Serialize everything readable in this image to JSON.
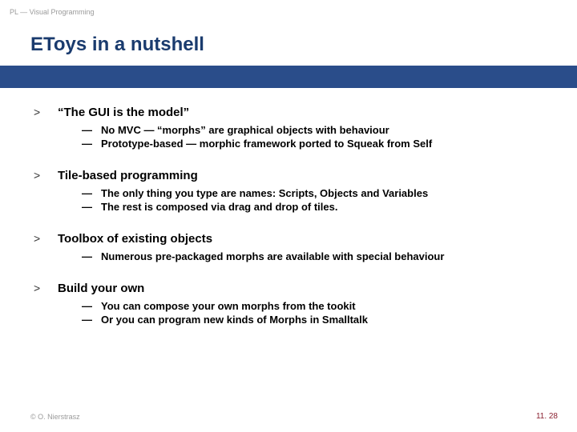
{
  "header": "PL — Visual Programming",
  "title": "EToys in a nutshell",
  "sections": [
    {
      "title": "“The GUI is the model”",
      "subs": [
        "No MVC — “morphs” are graphical objects with behaviour",
        "Prototype-based — morphic framework ported to Squeak from Self"
      ]
    },
    {
      "title": "Tile-based programming",
      "subs": [
        "The only thing you type are names: Scripts, Objects and Variables",
        "The rest is composed via drag and drop of tiles."
      ]
    },
    {
      "title": "Toolbox of existing objects",
      "subs": [
        "Numerous pre-packaged morphs are available with special behaviour"
      ]
    },
    {
      "title": "Build your own",
      "subs": [
        "You can compose your own morphs from the tookit",
        "Or you can program new kinds of Morphs in Smalltalk"
      ]
    }
  ],
  "footer_left": "© O. Nierstrasz",
  "footer_right": "11. 28",
  "bullet_outer": ">",
  "bullet_inner": "—"
}
